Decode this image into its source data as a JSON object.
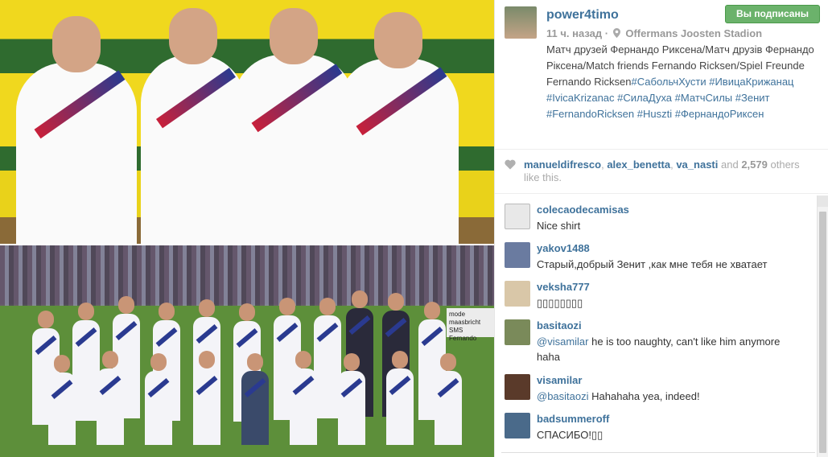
{
  "post": {
    "username": "power4timo",
    "follow_label": "Вы подписаны",
    "time_ago": "11 ч. назад",
    "location": "Offermans Joosten Stadion",
    "caption_text": "Матч друзей Фернандо Риксена/Матч друзів Фернандо Ріксена/Match friends Fernando Ricksen/Spiel Freunde Fernando Ricksen",
    "caption_tags": [
      "#СабольчХусти",
      "#ИвицаКрижанац",
      "#IvicaKrizanac",
      "#СилаДуха",
      "#МатчСилы",
      "#Зенит",
      "#FernandoRicksen",
      "#Huszti",
      "#ФернандоРиксен"
    ]
  },
  "photo": {
    "banner_text": "mode maasbricht SMS Fernando"
  },
  "likes": {
    "user1": "manueldifresco",
    "user2": "alex_benetta",
    "user3": "va_nasti",
    "and_label": "and",
    "count": "2,579",
    "suffix": "others like this."
  },
  "comments": [
    {
      "user": "colecaodecamisas",
      "mention": "",
      "text": "Nice shirt",
      "avatar_color": "#e8e8e8"
    },
    {
      "user": "yakov1488",
      "mention": "",
      "text": "Старый,добрый Зенит ,как мне тебя не хватает",
      "avatar_color": "#6a7ba0"
    },
    {
      "user": "veksha777",
      "mention": "",
      "text": "▯▯▯▯▯▯▯▯",
      "avatar_color": "#d9c7a8"
    },
    {
      "user": "basitaozi",
      "mention": "@visamilar",
      "text": "he is too naughty, can't like him anymore haha",
      "avatar_color": "#7a8a5a"
    },
    {
      "user": "visamilar",
      "mention": "@basitaozi",
      "text": "Hahahaha yea, indeed!",
      "avatar_color": "#5a3a2a"
    },
    {
      "user": "badsummeroff",
      "mention": "",
      "text": "СПАСИБО!▯▯",
      "avatar_color": "#4a6a8a"
    }
  ],
  "colors": {
    "link": "#3f729b",
    "follow_green": "#6bb26b"
  }
}
